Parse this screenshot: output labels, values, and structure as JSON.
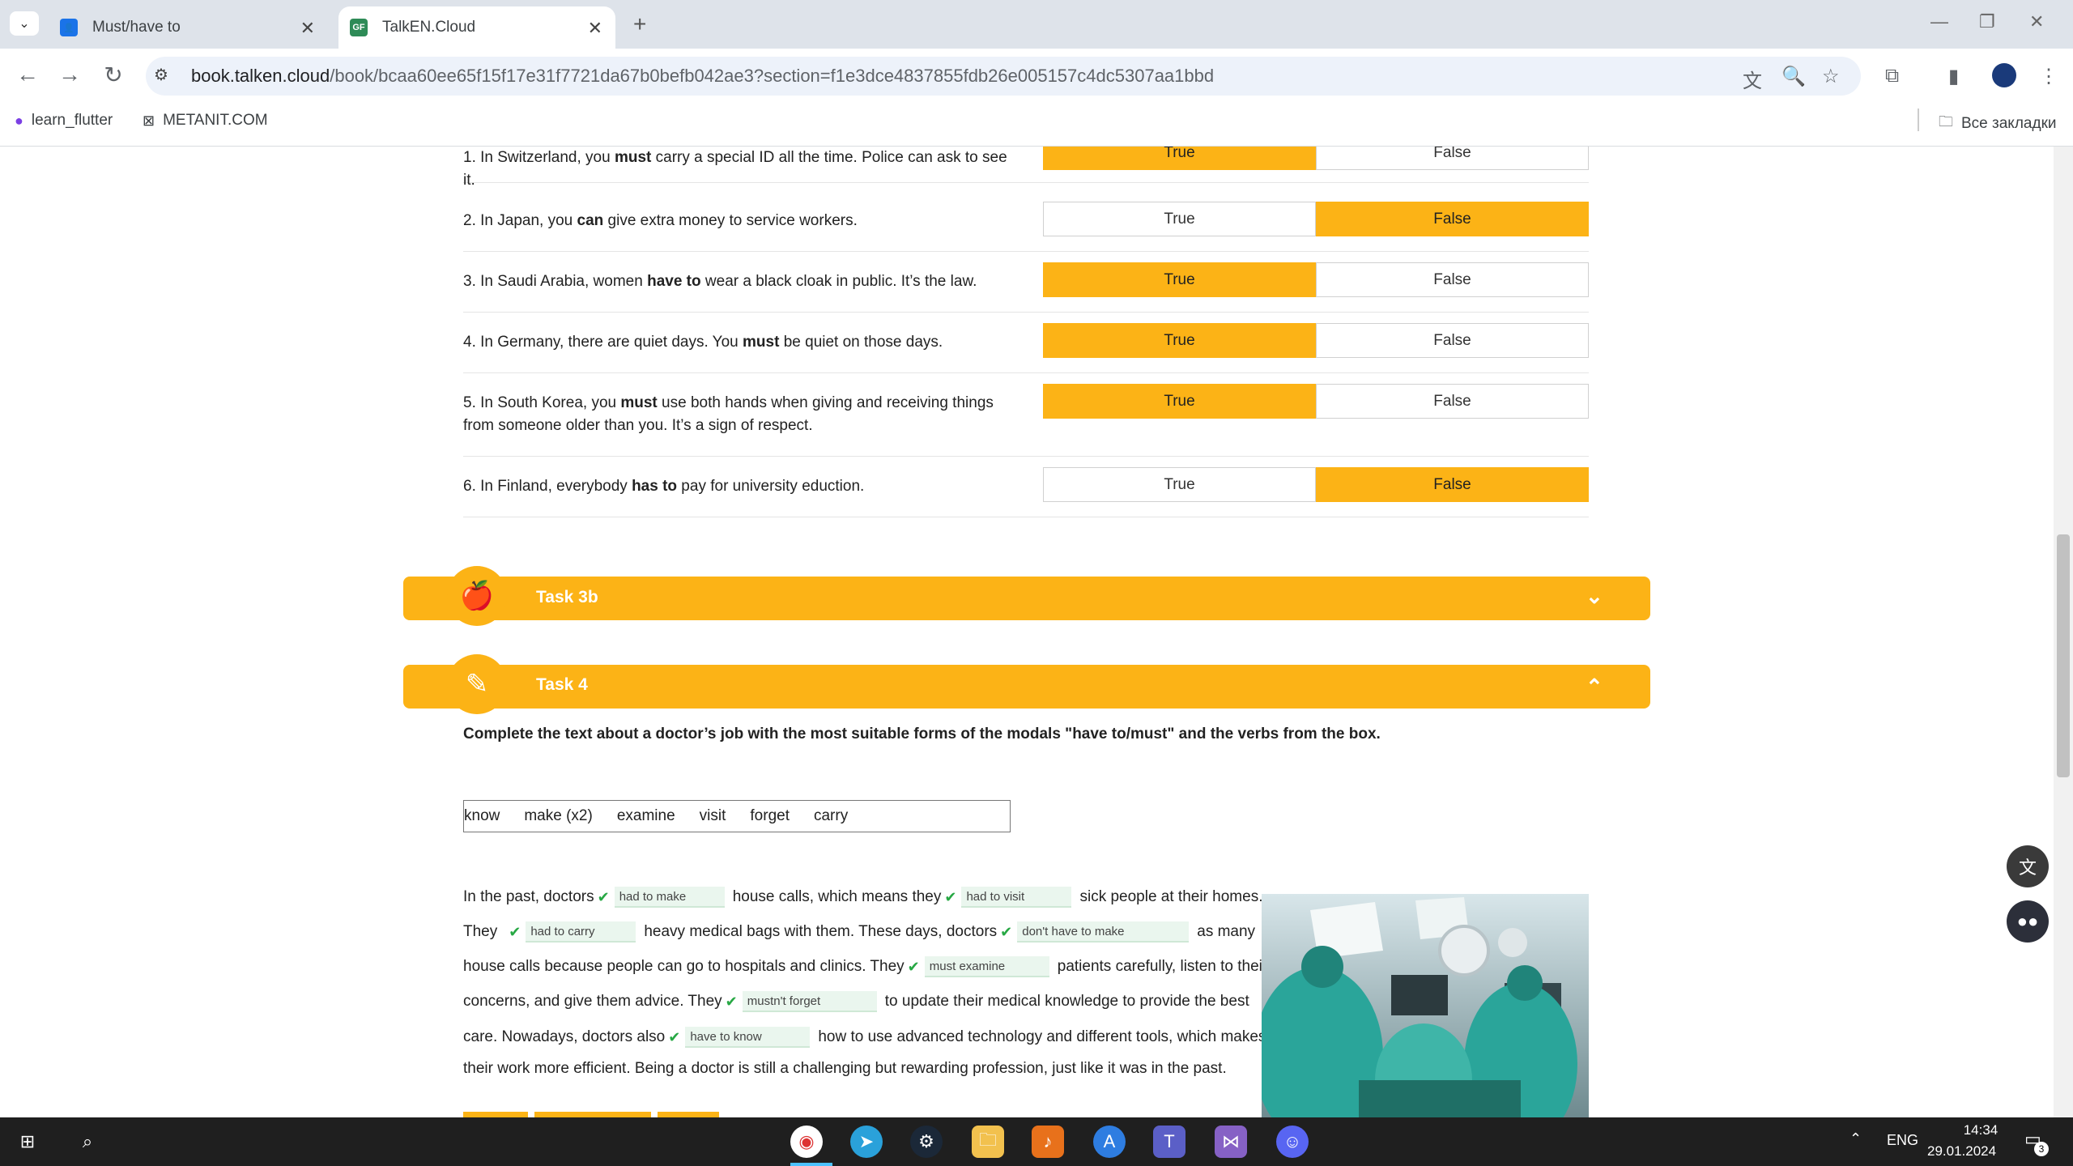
{
  "browser": {
    "tabs": [
      {
        "title": "Must/have to",
        "favicon": "user-square-icon",
        "active": false
      },
      {
        "title": "TalkEN.Cloud",
        "favicon": "GF",
        "active": true
      }
    ],
    "url_host": "book.talken.cloud",
    "url_rest": "/book/bcaa60ee65f15f17e31f7721da67b0befb042ae3?section=f1e3dce4837855fdb26e005157c4dc5307aa1bbd",
    "bookmarks": [
      {
        "label": "learn_flutter"
      },
      {
        "label": "METANIT.COM"
      }
    ],
    "all_bookmarks": "Все закладки"
  },
  "task3a": {
    "rows": [
      {
        "pre": "1. In Switzerland, you ",
        "bold": "must",
        "post": " carry a special ID all the time. Police can ask to see it.",
        "selected": "True"
      },
      {
        "pre": "2. In Japan, you ",
        "bold": "can",
        "post": " give extra money to service workers.",
        "selected": "False"
      },
      {
        "pre": "3. In Saudi Arabia, women ",
        "bold": "have to",
        "post": " wear a black cloak in public. It’s the law.",
        "selected": "True"
      },
      {
        "pre": "4. In Germany, there are quiet days. You ",
        "bold": "must",
        "post": " be quiet on those days.",
        "selected": "True"
      },
      {
        "pre": "5. In South Korea, you ",
        "bold": "must",
        "post": " use both hands when giving and receiving things from someone older than you. It’s a sign of respect.",
        "selected": "True"
      },
      {
        "pre": "6. In Finland, everybody ",
        "bold": "has to",
        "post": " pay for university eduction.",
        "selected": "False"
      }
    ],
    "true_label": "True",
    "false_label": "False"
  },
  "task3b": {
    "title": "Task 3b",
    "expanded": false
  },
  "task4": {
    "title": "Task 4",
    "expanded": true,
    "instruction": "Complete the text about a doctor’s job with the most suitable forms of the modals \"have to/must\" and the verbs from the box.",
    "words": [
      "know",
      "make (x2)",
      "examine",
      "visit",
      "forget",
      "carry"
    ],
    "text": {
      "l1_a": "In the past, doctors",
      "a1": "had to make",
      "l1_b": "house calls, which means they",
      "a2": "had to visit",
      "l1_c": "sick people at their homes.",
      "l2_a": "They",
      "a3": "had to carry",
      "l2_b": "heavy medical bags with them. These days, doctors",
      "a4": "don't have to make",
      "l2_c": "as many",
      "l3_a": "house calls because people can go to hospitals and clinics. They",
      "a5": "must examine",
      "l3_b": "patients carefully, listen to their",
      "l4_a": "concerns, and give them advice. They",
      "a6": "mustn't forget",
      "l4_b": "to update their medical knowledge to provide the best",
      "l5_a": "care. Nowadays, doctors also",
      "a7": "have to know",
      "l5_b": "how to use advanced technology and different tools, which makes",
      "l6": "their work more efficient. Being a doctor is still a challenging but rewarding profession, just like it was in the past."
    }
  },
  "taskbar": {
    "lang": "ENG",
    "time": "14:34",
    "date": "29.01.2024",
    "notifications": "3"
  },
  "colors": {
    "accent": "#fcb316",
    "check": "#27a844"
  }
}
